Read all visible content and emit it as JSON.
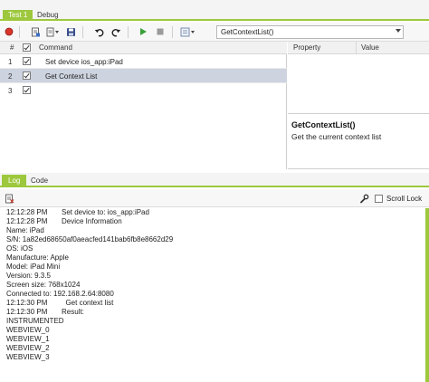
{
  "tabs": [
    {
      "label": "Test 1",
      "active": true
    },
    {
      "label": "Debug",
      "active": false
    }
  ],
  "toolbar": {
    "icons": [
      "record-icon",
      "new-step-icon",
      "insert-dropdown-icon",
      "save-icon",
      "undo-icon",
      "redo-icon",
      "play-icon",
      "stop-icon",
      "options-dropdown-icon"
    ],
    "command_combo": "GetContextList()"
  },
  "grid": {
    "headers": {
      "num": "#",
      "command": "Command"
    },
    "rows": [
      {
        "num": "1",
        "checked": true,
        "command": "Set device  ios_app:iPad",
        "selected": false
      },
      {
        "num": "2",
        "checked": true,
        "command": "Get Context List",
        "selected": true
      },
      {
        "num": "3",
        "checked": true,
        "command": "",
        "selected": false
      }
    ]
  },
  "properties": {
    "headers": {
      "property": "Property",
      "value": "Value"
    }
  },
  "help": {
    "title": "GetContextList()",
    "description": "Get the current context list"
  },
  "log_tabs": [
    {
      "label": "Log",
      "active": true
    },
    {
      "label": "Code",
      "active": false
    }
  ],
  "log_toolbar": {
    "scroll_lock_label": "Scroll Lock"
  },
  "log_lines": [
    {
      "time": "12:12:28 PM",
      "msg": "Set device to: ios_app:iPad"
    },
    {
      "time": "12:12:28 PM",
      "msg": "Device Information"
    },
    {
      "time": "",
      "msg": "Name: iPad"
    },
    {
      "time": "",
      "msg": "S/N: 1a82ed68650af0aeacfed141bab6fb8e8662d29"
    },
    {
      "time": "",
      "msg": "OS: iOS"
    },
    {
      "time": "",
      "msg": "Manufacture: Apple"
    },
    {
      "time": "",
      "msg": "Model: iPad Mini"
    },
    {
      "time": "",
      "msg": "Version: 9.3.5"
    },
    {
      "time": "",
      "msg": "Screen size: 768x1024"
    },
    {
      "time": "",
      "msg": "Connected to: 192.168.2.64:8080"
    },
    {
      "time": "12:12:30 PM",
      "msg": "  Get context list"
    },
    {
      "time": "12:12:30 PM",
      "msg": "Result:"
    },
    {
      "time": "",
      "msg": "INSTRUMENTED"
    },
    {
      "time": "",
      "msg": "WEBVIEW_0"
    },
    {
      "time": "",
      "msg": "WEBVIEW_1"
    },
    {
      "time": "",
      "msg": "WEBVIEW_2"
    },
    {
      "time": "",
      "msg": "WEBVIEW_3"
    }
  ],
  "colors": {
    "accent": "#9dc83d",
    "selection": "#cdd3df",
    "record": "#d9342b",
    "play": "#3aa03a"
  }
}
